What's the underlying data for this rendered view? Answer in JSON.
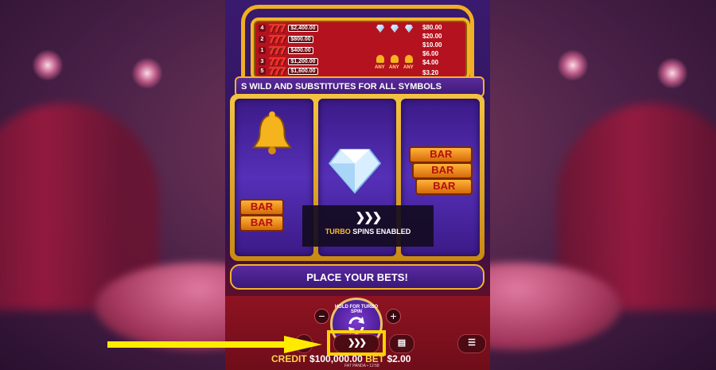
{
  "paytable": {
    "rows": [
      {
        "num": "4",
        "prize": "$2,400.00"
      },
      {
        "num": "2",
        "prize": "$800.00"
      },
      {
        "num": "1",
        "prize": "$400.00"
      },
      {
        "num": "3",
        "prize": "$1,200.00"
      },
      {
        "num": "5",
        "prize": "$1,600.00"
      }
    ],
    "sevens": "777",
    "any_label": "ANY",
    "payouts": [
      "$80.00",
      "$20.00",
      "$10.00",
      "$6.00",
      "$4.00",
      "$3.20"
    ]
  },
  "banner": {
    "text": "S WILD AND SUBSTITUTES FOR ALL SYMBOLS"
  },
  "reels": {
    "bar_label": "BAR"
  },
  "turbo_overlay": {
    "icon": "turbo-icon",
    "text_highlight": "TURBO",
    "text_rest": " SPINS ENABLED"
  },
  "message": "PLACE YOUR BETS!",
  "spin_button": {
    "hold_text": "HOLD FOR TURBO SPIN",
    "icon": "refresh-icon"
  },
  "controls": {
    "minus": "−",
    "plus": "+",
    "turbo_icon": "turbo-icon",
    "coins_icon": "coins-icon",
    "menu_icon": "menu-icon"
  },
  "stats": {
    "credit_label": "CREDIT",
    "credit_value": "$100,000.00",
    "bet_label": "BET",
    "bet_value": "$2.00"
  },
  "footer": "FAT PANDA • 12:58",
  "annotation": {
    "arrow_color": "#ffeb00",
    "box_color": "#ffd300"
  }
}
